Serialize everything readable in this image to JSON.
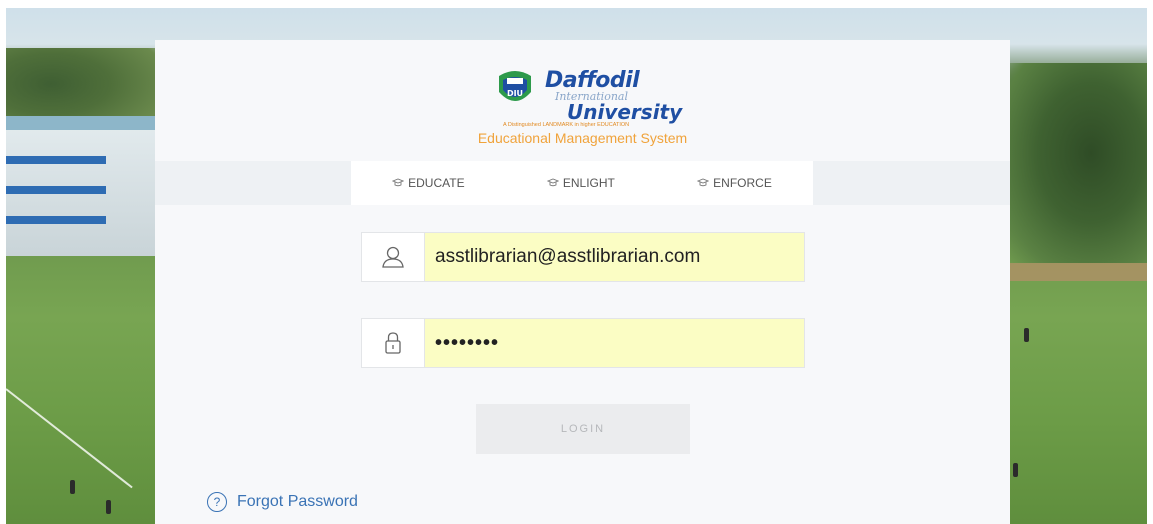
{
  "brand": {
    "name_line1": "Daffodil",
    "name_line2": "International",
    "name_line3": "University",
    "tagline": "A Distinguished LANDMARK in higher EDUCATION",
    "emblem_text": "DIU",
    "system_title": "Educational Management System"
  },
  "nav": {
    "items": [
      {
        "label": "EDUCATE",
        "icon": "graduation-cap-icon"
      },
      {
        "label": "ENLIGHT",
        "icon": "graduation-cap-icon"
      },
      {
        "label": "ENFORCE",
        "icon": "graduation-cap-icon"
      }
    ]
  },
  "form": {
    "email": {
      "value": "asstlibrarian@asstlibrarian.com",
      "icon": "user-icon"
    },
    "password": {
      "value": "••••••••",
      "icon": "lock-icon"
    },
    "login_label": "LOGIN",
    "forgot_label": "Forgot Password",
    "forgot_icon_glyph": "?"
  },
  "colors": {
    "accent_orange": "#f0a33b",
    "brand_blue": "#1f4fa3",
    "autofill_yellow": "#fbfdc4",
    "link_blue": "#3a73b5"
  }
}
